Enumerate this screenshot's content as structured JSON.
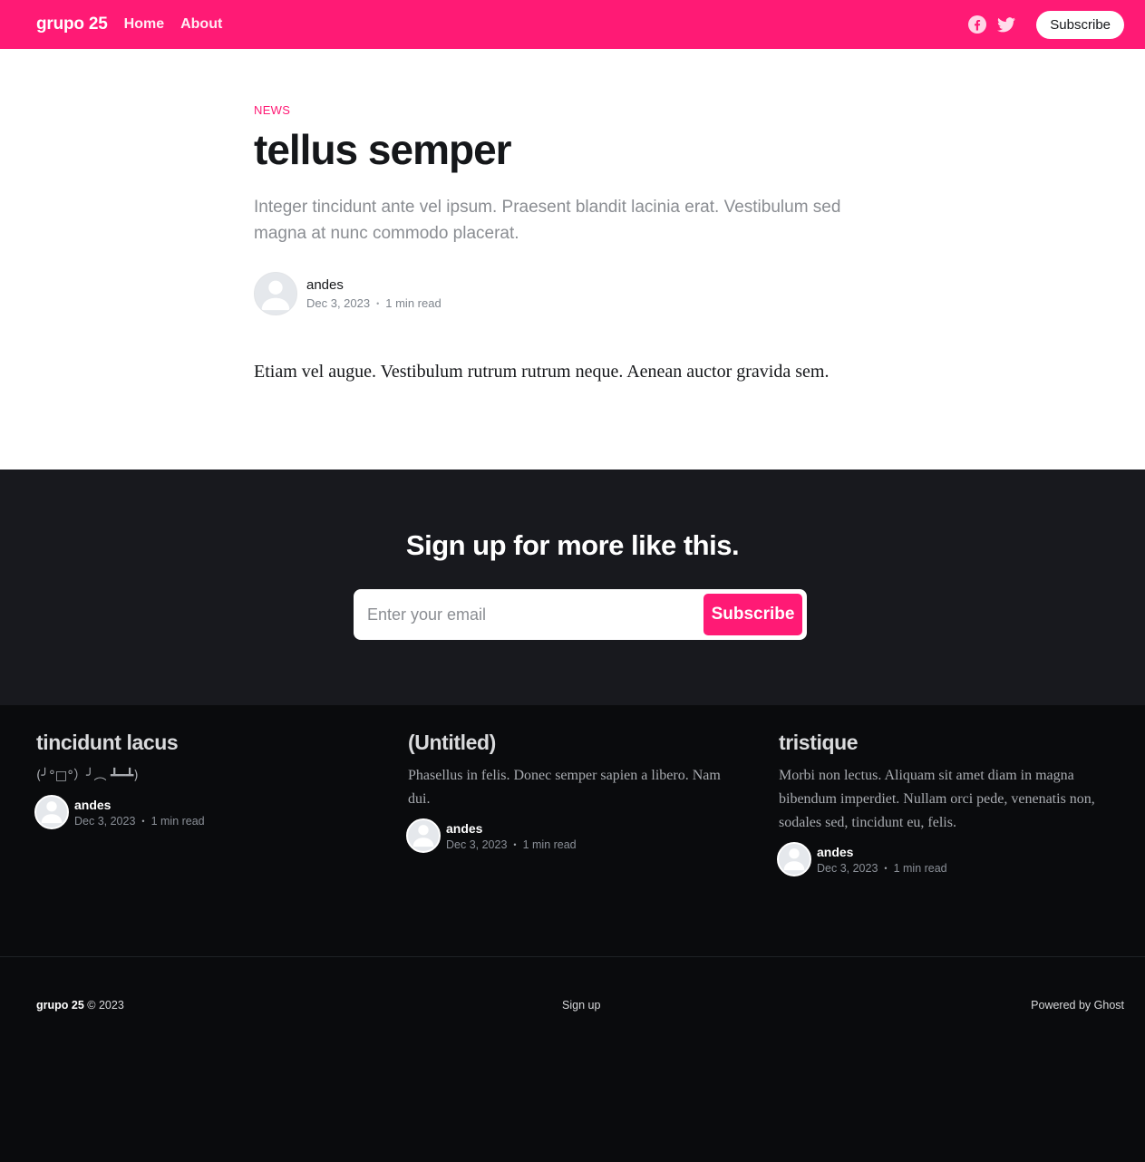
{
  "site": {
    "brand": "grupo 25",
    "nav": [
      {
        "label": "Home"
      },
      {
        "label": "About"
      }
    ],
    "subscribe_label": "Subscribe"
  },
  "post": {
    "tag": "News",
    "title": "tellus semper",
    "excerpt": "Integer tincidunt ante vel ipsum. Praesent blandit lacinia erat. Vestibulum sed magna at nunc commodo placerat.",
    "author": "andes",
    "date": "Dec 3, 2023",
    "reading_time": "1 min read",
    "body": "Etiam vel augue. Vestibulum rutrum rutrum neque. Aenean auctor gravida sem."
  },
  "cta": {
    "title": "Sign up for more like this.",
    "email_placeholder": "Enter your email",
    "button_label": "Subscribe"
  },
  "related": [
    {
      "title": "tincidunt lacus",
      "excerpt": "(╯°□°）╯︵ ┻━┻)",
      "author": "andes",
      "date": "Dec 3, 2023",
      "reading_time": "1 min read"
    },
    {
      "title": "(Untitled)",
      "excerpt": "Phasellus in felis. Donec semper sapien a libero. Nam dui.",
      "author": "andes",
      "date": "Dec 3, 2023",
      "reading_time": "1 min read"
    },
    {
      "title": "tristique",
      "excerpt": "Morbi non lectus. Aliquam sit amet diam in magna bibendum imperdiet. Nullam orci pede, venenatis non, sodales sed, tincidunt eu, felis.",
      "author": "andes",
      "date": "Dec 3, 2023",
      "reading_time": "1 min read"
    }
  ],
  "footer": {
    "brand": "grupo 25",
    "copyright": "© 2023",
    "signup_link": "Sign up",
    "powered_by": "Powered by Ghost"
  },
  "colors": {
    "accent": "#ff1a75",
    "cta_background": "#18191e",
    "footer_background": "#0a0b0d"
  },
  "icons": [
    "facebook-icon",
    "twitter-icon",
    "avatar-icon"
  ]
}
